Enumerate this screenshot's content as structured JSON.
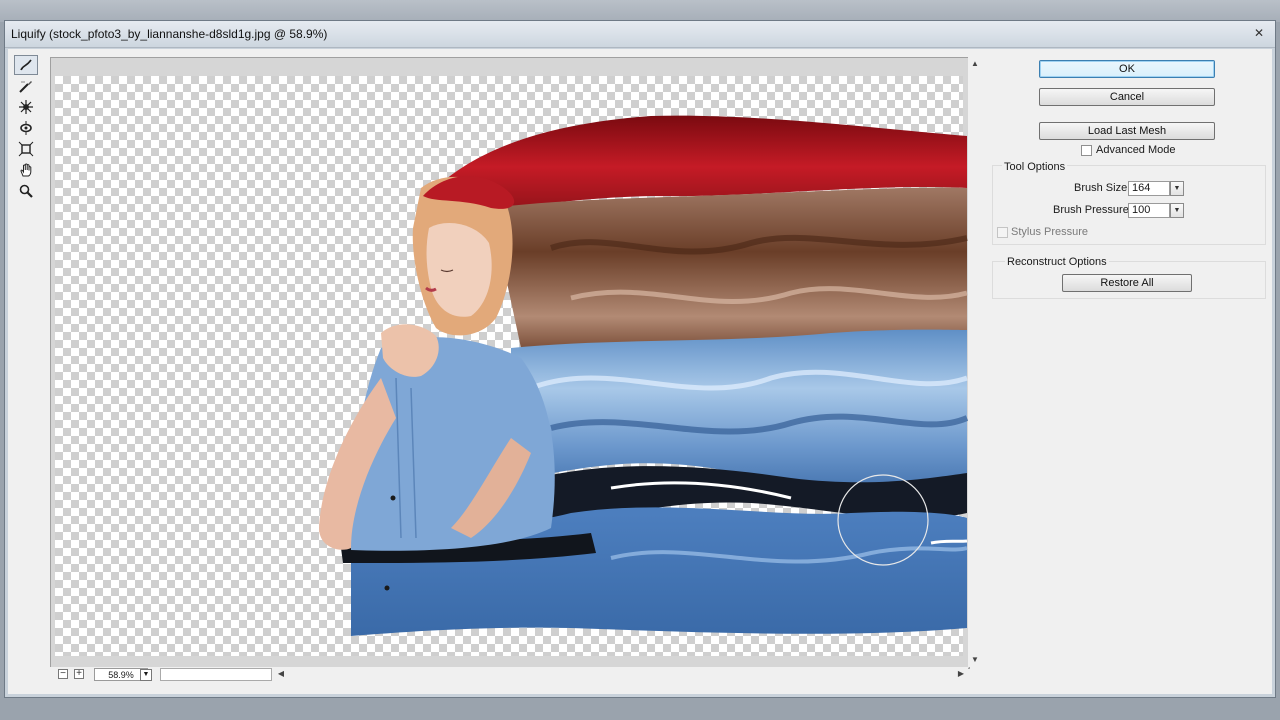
{
  "window": {
    "title": "Liquify (stock_pfoto3_by_liannanshe-d8sld1g.jpg @ 58.9%)"
  },
  "tools": [
    {
      "name": "forward-warp-tool-icon",
      "active": true
    },
    {
      "name": "reconstruct-tool-icon",
      "active": false
    },
    {
      "name": "pucker-tool-icon",
      "active": false
    },
    {
      "name": "bloat-tool-icon",
      "active": false
    },
    {
      "name": "push-left-tool-icon",
      "active": false
    },
    {
      "name": "hand-tool-icon",
      "active": false
    },
    {
      "name": "zoom-tool-icon",
      "active": false
    }
  ],
  "zoom": {
    "value": "58.9%",
    "minus_icon": "minus-icon",
    "plus_icon": "plus-icon"
  },
  "buttons": {
    "ok": "OK",
    "cancel": "Cancel",
    "load_last_mesh": "Load Last Mesh",
    "restore_all": "Restore All"
  },
  "advanced_mode": {
    "label": "Advanced Mode",
    "checked": false
  },
  "tool_options": {
    "title": "Tool Options",
    "brush_size_label": "Brush Size:",
    "brush_size_value": "164",
    "brush_pressure_label": "Brush Pressure:",
    "brush_pressure_value": "100",
    "stylus_pressure_label": "Stylus Pressure",
    "stylus_pressure_checked": false
  },
  "reconstruct_options": {
    "title": "Reconstruct Options"
  },
  "colors": {
    "default_button_border": "#3c7fb1",
    "hair_red": "#b0101c",
    "dress_blue": "#6f9fd0"
  }
}
